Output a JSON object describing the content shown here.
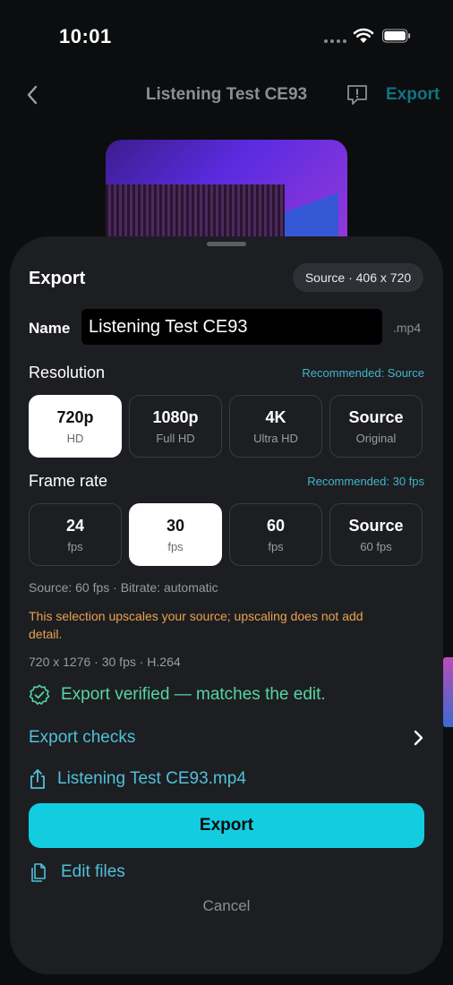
{
  "status_bar": {
    "time": "10:01"
  },
  "header": {
    "title": "Listening Test CE93",
    "export_label": "Export"
  },
  "sheet": {
    "title": "Export",
    "source_badge": "Source · 406 x 720",
    "name_label": "Name",
    "name_value": "Listening Test CE93",
    "extension": ".mp4",
    "resolution": {
      "label": "Resolution",
      "recommended": "Recommended: Source",
      "options": [
        {
          "main": "720p",
          "sub": "HD",
          "selected": true
        },
        {
          "main": "1080p",
          "sub": "Full HD",
          "selected": false
        },
        {
          "main": "4K",
          "sub": "Ultra HD",
          "selected": false
        },
        {
          "main": "Source",
          "sub": "Original",
          "selected": false
        }
      ]
    },
    "frame_rate": {
      "label": "Frame rate",
      "recommended": "Recommended: 30 fps",
      "options": [
        {
          "main": "24",
          "sub": "fps",
          "selected": false
        },
        {
          "main": "30",
          "sub": "fps",
          "selected": true
        },
        {
          "main": "60",
          "sub": "fps",
          "selected": false
        },
        {
          "main": "Source",
          "sub": "60 fps",
          "selected": false
        }
      ]
    },
    "source_info": "Source: 60 fps · Bitrate: automatic",
    "warning": "This selection upscales your source; upscaling does not add detail.",
    "output_summary": "720 x 1276 · 30 fps · H.264",
    "verified_text": "Export verified — matches the edit.",
    "export_checks": "Export checks",
    "file_name": "Listening Test CE93.mp4",
    "export_button": "Export",
    "edit_files": "Edit files",
    "cancel": "Cancel"
  },
  "colors": {
    "accent": "#12cde0",
    "link": "#4fc1d8",
    "success": "#55d6a0",
    "warning": "#e9a24f"
  }
}
